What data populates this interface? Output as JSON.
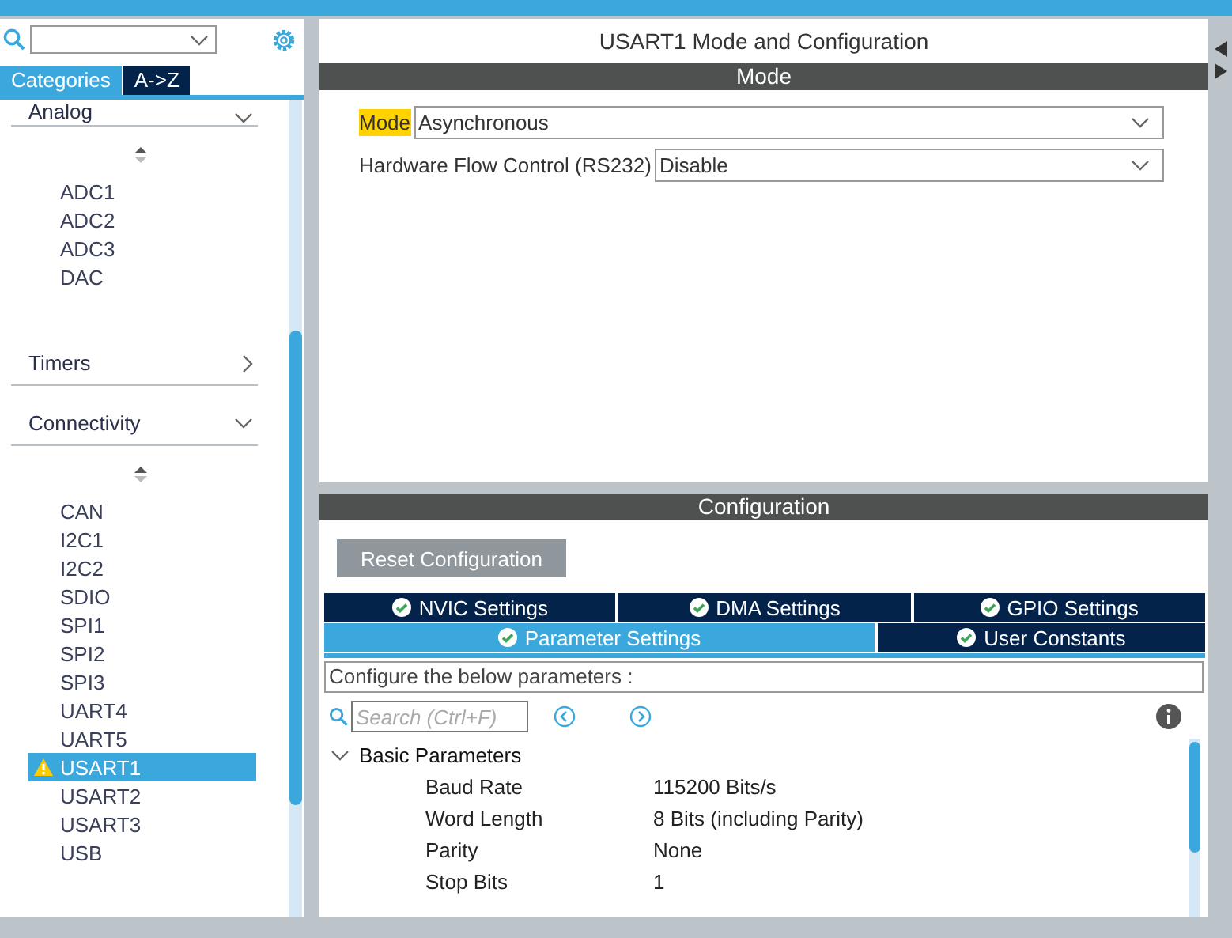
{
  "sidebar": {
    "tabs": [
      {
        "label": "Categories",
        "selected": true
      },
      {
        "label": "A->Z",
        "selected": false
      }
    ],
    "categories": [
      {
        "label": "Analog",
        "expanded": true,
        "items": [
          {
            "label": "ADC1",
            "selected": false,
            "warning": false
          },
          {
            "label": "ADC2",
            "selected": false,
            "warning": false
          },
          {
            "label": "ADC3",
            "selected": false,
            "warning": false
          },
          {
            "label": "DAC",
            "selected": false,
            "warning": false
          }
        ]
      },
      {
        "label": "Timers",
        "expanded": false
      },
      {
        "label": "Connectivity",
        "expanded": true,
        "items": [
          {
            "label": "CAN",
            "selected": false,
            "warning": false
          },
          {
            "label": "I2C1",
            "selected": false,
            "warning": false
          },
          {
            "label": "I2C2",
            "selected": false,
            "warning": false
          },
          {
            "label": "SDIO",
            "selected": false,
            "warning": false
          },
          {
            "label": "SPI1",
            "selected": false,
            "warning": false
          },
          {
            "label": "SPI2",
            "selected": false,
            "warning": false
          },
          {
            "label": "SPI3",
            "selected": false,
            "warning": false
          },
          {
            "label": "UART4",
            "selected": false,
            "warning": false
          },
          {
            "label": "UART5",
            "selected": false,
            "warning": false
          },
          {
            "label": "USART1",
            "selected": true,
            "warning": true
          },
          {
            "label": "USART2",
            "selected": false,
            "warning": false
          },
          {
            "label": "USART3",
            "selected": false,
            "warning": false
          },
          {
            "label": "USB",
            "selected": false,
            "warning": false
          }
        ]
      }
    ]
  },
  "main": {
    "title": "USART1 Mode and Configuration",
    "mode_section": {
      "header": "Mode",
      "fields": [
        {
          "label": "Mode",
          "value": "Asynchronous",
          "highlighted": true
        },
        {
          "label": "Hardware Flow Control (RS232)",
          "value": "Disable",
          "highlighted": false
        }
      ]
    },
    "config_section": {
      "header": "Configuration",
      "reset_button": "Reset Configuration",
      "tab_rows": [
        [
          {
            "label": "NVIC Settings",
            "selected": false
          },
          {
            "label": "DMA Settings",
            "selected": false
          },
          {
            "label": "GPIO Settings",
            "selected": false
          }
        ],
        [
          {
            "label": "Parameter Settings",
            "selected": true
          },
          {
            "label": "User Constants",
            "selected": false
          }
        ]
      ],
      "description": "Configure the below parameters :",
      "search": {
        "placeholder": "Search (Ctrl+F)"
      },
      "groups": [
        {
          "label": "Basic Parameters",
          "expanded": true,
          "params": [
            {
              "name": "Baud Rate",
              "value": "115200 Bits/s"
            },
            {
              "name": "Word Length",
              "value": "8 Bits (including Parity)"
            },
            {
              "name": "Parity",
              "value": "None"
            },
            {
              "name": "Stop Bits",
              "value": "1"
            }
          ]
        }
      ]
    }
  }
}
